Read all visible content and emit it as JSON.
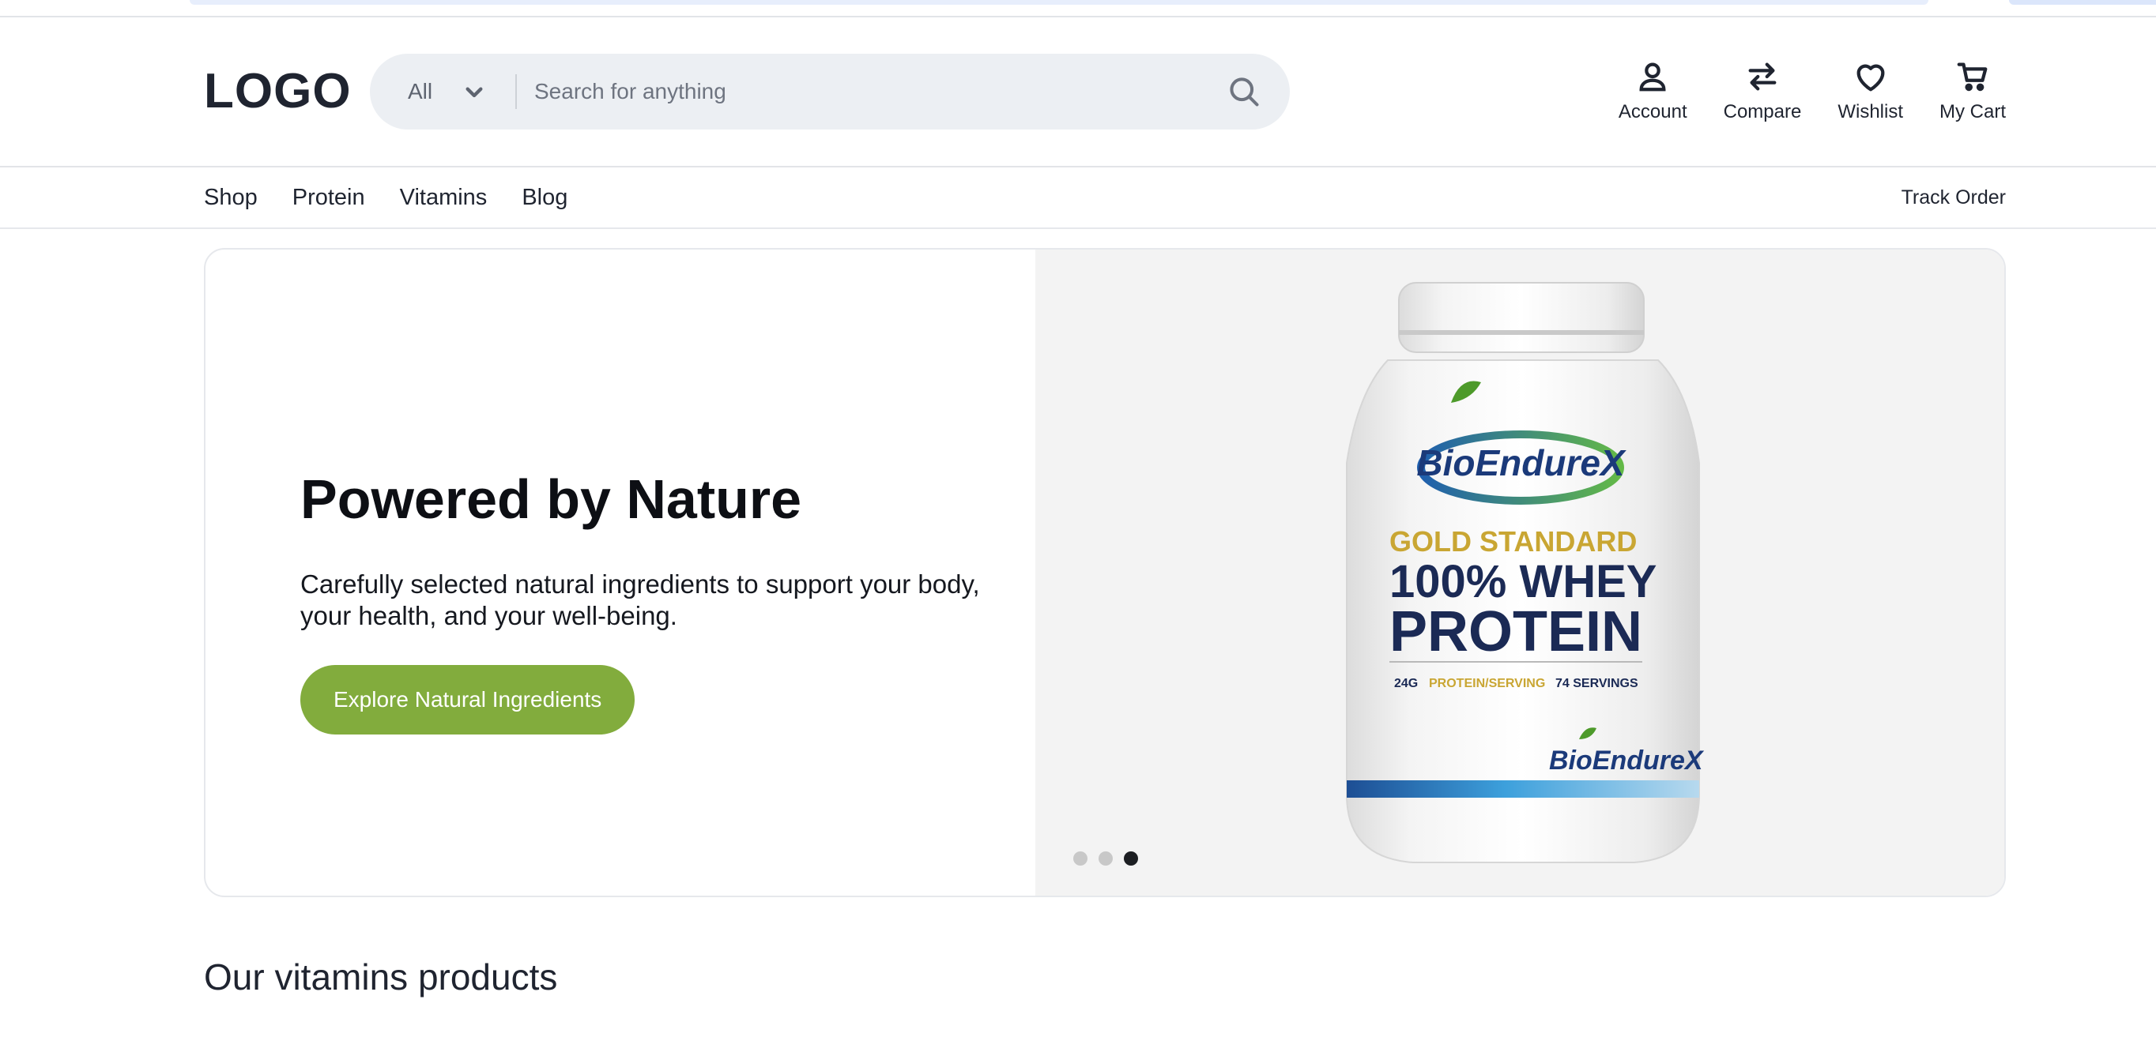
{
  "header": {
    "logo": "LOGO",
    "search": {
      "category": "All",
      "placeholder": "Search for anything"
    },
    "actions": [
      {
        "label": "Account",
        "icon": "user-icon"
      },
      {
        "label": "Compare",
        "icon": "compare-arrows-icon"
      },
      {
        "label": "Wishlist",
        "icon": "heart-icon"
      },
      {
        "label": "My Cart",
        "icon": "cart-icon"
      }
    ]
  },
  "nav": {
    "links": [
      "Shop",
      "Protein",
      "Vitamins",
      "Blog"
    ],
    "track_order": "Track Order"
  },
  "hero": {
    "title": "Powered by Nature",
    "subtitle": "Carefully selected natural ingredients to support your body, your health, and your well-being.",
    "cta": "Explore Natural Ingredients",
    "slide_count": 3,
    "active_slide": 3,
    "product": {
      "brand": "BioEndureX",
      "line1": "GOLD STANDARD",
      "line2": "100% WHEY",
      "line3": "PROTEIN",
      "spec_a": "24G",
      "spec_b": "PROTEIN/SERVING",
      "spec_c": "74 SERVINGS"
    }
  },
  "sections": {
    "vitamins_title": "Our vitamins products"
  },
  "colors": {
    "accent": "#82ac3d",
    "search_bg": "#eceff3",
    "brand_green": "#4d9a2a",
    "brand_blue": "#1b3a7a",
    "gold": "#c9a633"
  }
}
